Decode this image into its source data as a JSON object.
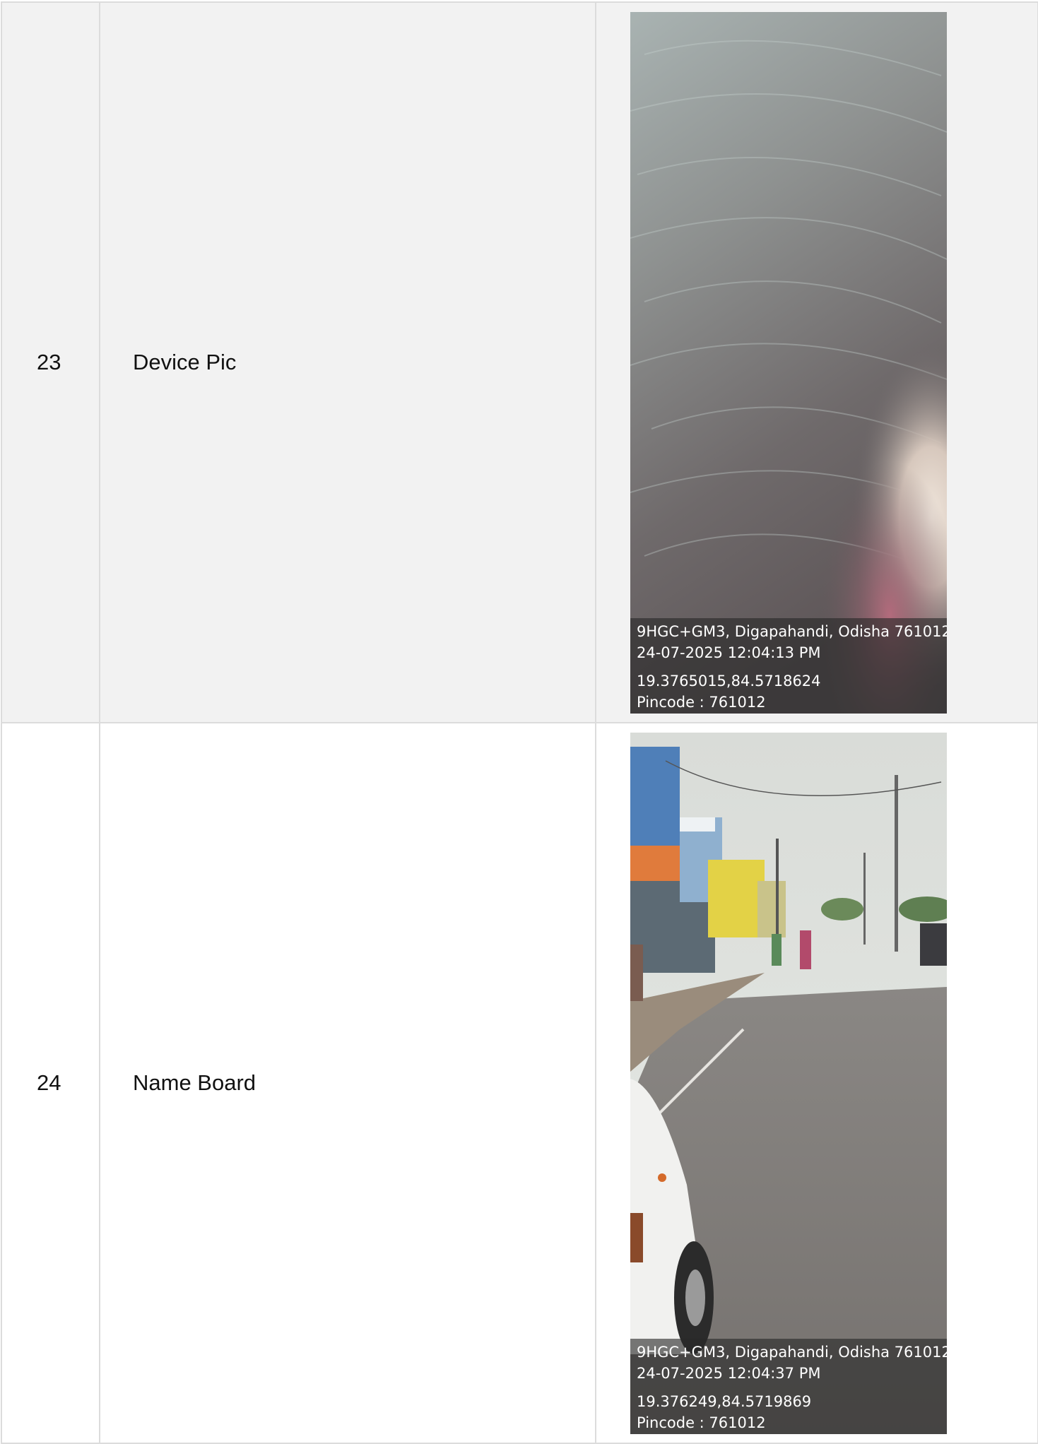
{
  "rows": [
    {
      "number": "23",
      "label": "Device Pic",
      "photo": {
        "icon": "device-photo",
        "stamp": {
          "address": "9HGC+GM3, Digapahandi, Odisha 761012",
          "datetime": "24-07-2025 12:04:13 PM",
          "coords": "19.3765015,84.5718624",
          "pincode": "Pincode : 761012"
        }
      }
    },
    {
      "number": "24",
      "label": "Name Board",
      "photo": {
        "icon": "street-photo",
        "stamp": {
          "address": "9HGC+GM3, Digapahandi, Odisha 761012",
          "datetime": "24-07-2025 12:04:37 PM",
          "coords": "19.376249,84.5719869",
          "pincode": "Pincode : 761012"
        }
      }
    }
  ]
}
